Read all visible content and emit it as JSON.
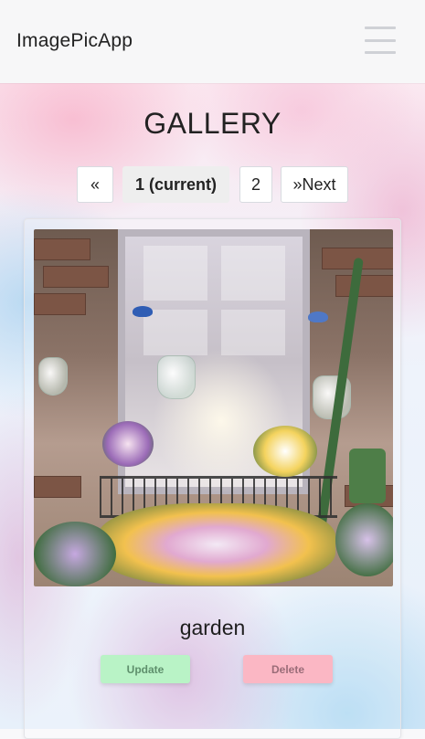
{
  "app": {
    "brand": "ImagePicApp",
    "menu_icon": "hamburger-menu-icon"
  },
  "page": {
    "title": "GALLERY"
  },
  "pagination": {
    "prev_label": "«",
    "current_label": "1 (current)",
    "page2_label": "2",
    "next_label": "»Next"
  },
  "gallery": {
    "items": [
      {
        "caption": "garden",
        "update_label": "Update",
        "delete_label": "Delete"
      }
    ]
  },
  "colors": {
    "update_button": "#b9f3c6",
    "delete_button": "#fbb7c4",
    "navbar": "#f7f7f8"
  }
}
